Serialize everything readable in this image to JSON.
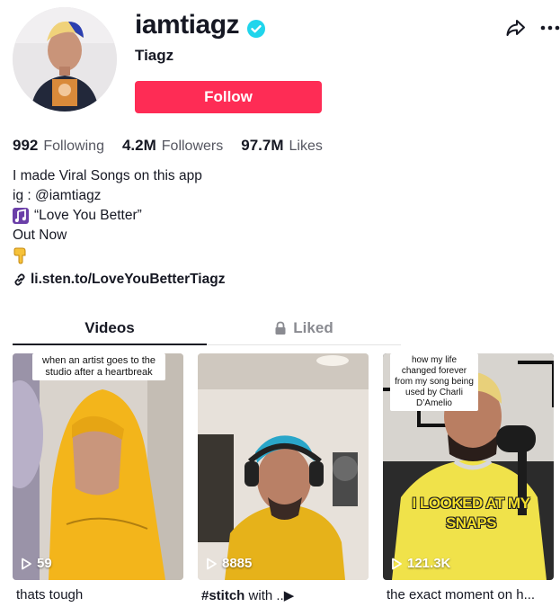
{
  "profile": {
    "username": "iamtiagz",
    "nickname": "Tiagz",
    "follow_label": "Follow"
  },
  "stats": {
    "following_count": "992",
    "following_label": "Following",
    "followers_count": "4.2M",
    "followers_label": "Followers",
    "likes_count": "97.7M",
    "likes_label": "Likes"
  },
  "bio": {
    "line1": "I made Viral Songs on this app",
    "line2": "ig : @iamtiagz",
    "line3": "“Love You Better”",
    "line4": "Out Now"
  },
  "link": {
    "text": "li.sten.to/LoveYouBetterTiagz"
  },
  "tabs": {
    "videos": "Videos",
    "liked": "Liked"
  },
  "videos": [
    {
      "caption": "when an artist goes to the studio after a heartbreak",
      "views": "59",
      "description": "thats tough"
    },
    {
      "views": "8885",
      "description_tag": "#stitch",
      "description_rest": " with ..▶"
    },
    {
      "caption": "how my life changed forever from my song being used by Charli D’Amelio",
      "overlay": "I LOOKED AT MY SNAPS",
      "views": "121.3K",
      "description": "the exact moment on h..."
    }
  ],
  "colors": {
    "accent": "#fe2c55",
    "verified": "#20d5ec",
    "text_primary": "#161823",
    "text_secondary": "#555660"
  },
  "icons": [
    "verified-badge-icon",
    "share-icon",
    "more-icon",
    "music-note-icon",
    "hand-pointing-down-icon",
    "link-icon",
    "lock-icon",
    "play-icon"
  ]
}
